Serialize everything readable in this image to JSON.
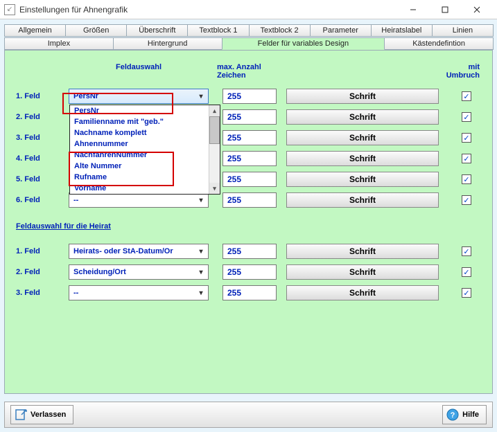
{
  "window": {
    "title": "Einstellungen für Ahnengrafik"
  },
  "tabs_row1": [
    {
      "label": "Allgemein"
    },
    {
      "label": "Größen"
    },
    {
      "label": "Überschrift"
    },
    {
      "label": "Textblock 1"
    },
    {
      "label": "Textblock 2"
    },
    {
      "label": "Parameter"
    },
    {
      "label": "Heiratslabel"
    },
    {
      "label": "Linien"
    }
  ],
  "tabs_row2": [
    {
      "label": "Implex"
    },
    {
      "label": "Hintergrund"
    },
    {
      "label": "Felder für variables Design",
      "active": true
    },
    {
      "label": "Kästendefintion"
    }
  ],
  "headers": {
    "feldauswahl": "Feldauswahl",
    "max_zeichen": "max. Anzahl Zeichen",
    "mit_umbruch": "mit Umbruch"
  },
  "dropdown_options": [
    "PersNr",
    "Familienname mit \"geb.\"",
    "Nachname komplett",
    "Ahnennummer",
    "NachfahrenNummer",
    "Alte Nummer",
    "Rufname",
    "Vorname"
  ],
  "fields": [
    {
      "label": "1. Feld",
      "value": "PersNr",
      "max": "255",
      "btn": "Schrift",
      "open": true
    },
    {
      "label": "2. Feld",
      "value": "",
      "max": "255",
      "btn": "Schrift"
    },
    {
      "label": "3. Feld",
      "value": "",
      "max": "255",
      "btn": "Schrift"
    },
    {
      "label": "4. Feld",
      "value": "",
      "max": "255",
      "btn": "Schrift"
    },
    {
      "label": "5. Feld",
      "value": "",
      "max": "255",
      "btn": "Schrift"
    },
    {
      "label": "6. Feld",
      "value": "--",
      "max": "255",
      "btn": "Schrift"
    }
  ],
  "heirat_title": "Feldauswahl für die Heirat",
  "heirat_fields": [
    {
      "label": "1. Feld",
      "value": "Heirats- oder StA-Datum/Or",
      "max": "255",
      "btn": "Schrift"
    },
    {
      "label": "2. Feld",
      "value": "Scheidung/Ort",
      "max": "255",
      "btn": "Schrift"
    },
    {
      "label": "3. Feld",
      "value": "--",
      "max": "255",
      "btn": "Schrift"
    }
  ],
  "footer": {
    "verlassen": "Verlassen",
    "hilfe": "Hilfe"
  }
}
